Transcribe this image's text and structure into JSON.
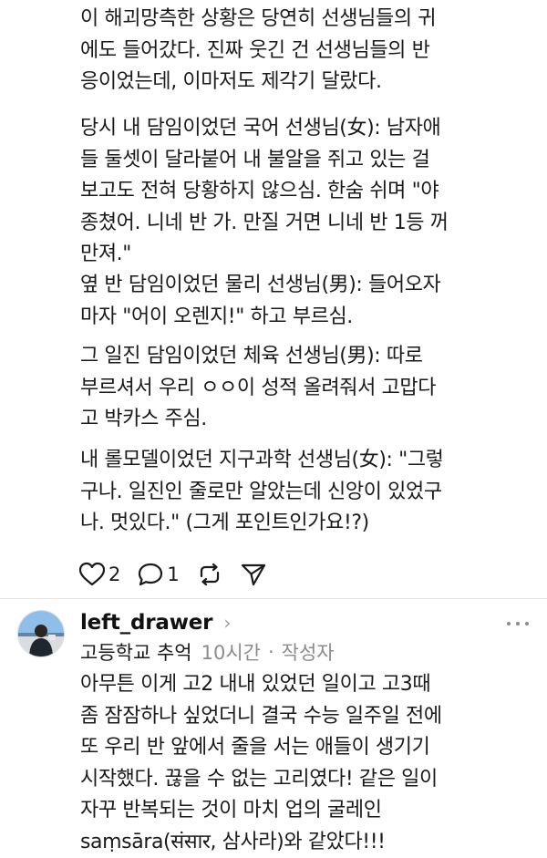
{
  "post": {
    "paragraphs": [
      "이 해괴망측한 상황은 당연히 선생님들의 귀\n에도 들어갔다. 진짜 웃긴 건 선생님들의 반\n응이었는데, 이마저도 제각기 달랐다.",
      "당시 내 담임이었던 국어 선생님(女): 남자애\n들 둘셋이 달라붙어 내 불알을 쥐고 있는 걸\n보고도 전혀 당황하지 않으심. 한숨 쉬며 \"야\n종쳤어. 니네 반 가. 만질 거면 니네 반 1등 꺼\n만져.\"",
      "옆 반 담임이었던 물리 선생님(男): 들어오자\n마자 \"어이 오렌지!\" 하고 부르심.",
      "그 일진 담임이었던 체육 선생님(男): 따로\n부르셔서 우리 ㅇㅇ이 성적 올려줘서 고맙다\n고 박카스 주심.",
      "내 롤모델이었던 지구과학 선생님(女): \"그렇\n구나. 일진인 줄로만 알았는데 신앙이 있었구\n나. 멋있다.\" (그게 포인트인가요!?)"
    ],
    "actions": {
      "like_count": "2",
      "reply_count": "1",
      "like_icon": "heart-icon",
      "reply_icon": "comment-icon",
      "repost_icon": "repost-icon",
      "share_icon": "send-icon"
    }
  },
  "reply": {
    "author": "left_drawer",
    "chevron": "›",
    "topic": "고등학교 추억",
    "time": "10시간",
    "separator": "·",
    "author_tag": "작성자",
    "text": "아무튼 이게 고2 내내 있었던 일이고 고3때\n좀 잠잠하나 싶었더니 결국 수능 일주일 전에\n또 우리 반 앞에서 줄을 서는 애들이 생기기\n시작했다. 끊을 수 없는 고리였다! 같은 일이\n자꾸 반복되는 것이 마치 업의 굴레인\nsaṃsāra(संसार, 삼사라)와 같았다!!!"
  },
  "colors": {
    "text": "#1a1a1a",
    "muted": "#8c8c8c",
    "divider": "#e4e4e4"
  }
}
